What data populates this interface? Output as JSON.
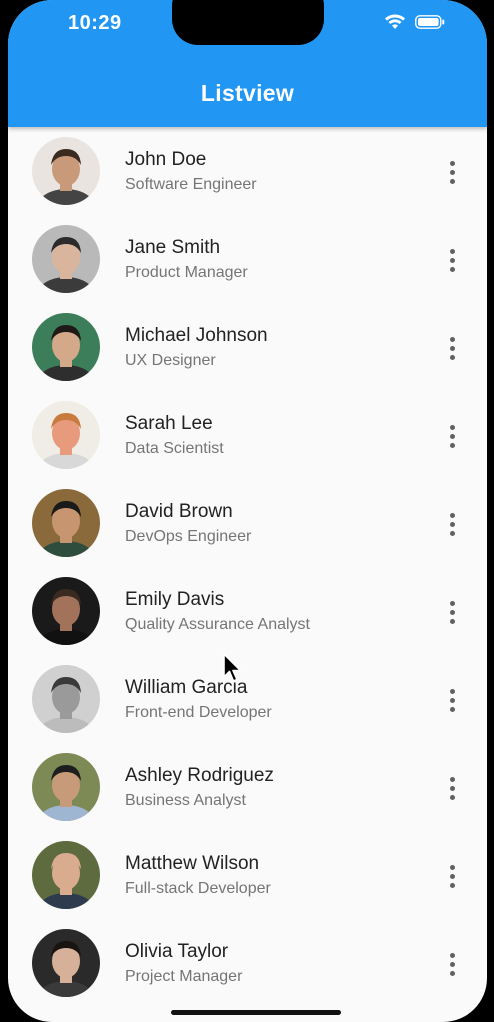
{
  "status_bar": {
    "time": "10:29",
    "icons": [
      "wifi-icon",
      "battery-icon"
    ]
  },
  "app_bar": {
    "title": "Listview",
    "color": "#2196F3"
  },
  "list": [
    {
      "name": "John Doe",
      "role": "Software Engineer",
      "bg": "#e9e4df",
      "skin": "#c99a7a",
      "hair": "#3a2a20",
      "shirt": "#444444"
    },
    {
      "name": "Jane Smith",
      "role": "Product Manager",
      "bg": "#b9b9b9",
      "skin": "#d9b59d",
      "hair": "#2b2b2b",
      "shirt": "#3b3b3b"
    },
    {
      "name": "Michael Johnson",
      "role": "UX Designer",
      "bg": "#3c7d5a",
      "skin": "#d4a98a",
      "hair": "#1f1a17",
      "shirt": "#2e2e2e"
    },
    {
      "name": "Sarah Lee",
      "role": "Data Scientist",
      "bg": "#f0ece6",
      "skin": "#e79a7c",
      "hair": "#c97a3e",
      "shirt": "#d8d8d8"
    },
    {
      "name": "David Brown",
      "role": "DevOps Engineer",
      "bg": "#8a6a3a",
      "skin": "#c79670",
      "hair": "#1a1a1a",
      "shirt": "#2f4d3d"
    },
    {
      "name": "Emily Davis",
      "role": "Quality Assurance Analyst",
      "bg": "#1a1a1a",
      "skin": "#a2735a",
      "hair": "#3a2a20",
      "shirt": "#111111"
    },
    {
      "name": "William Garcia",
      "role": "Front-end Developer",
      "bg": "#d0d0d0",
      "skin": "#9a9a9a",
      "hair": "#3a3a3a",
      "shirt": "#bcbcbc"
    },
    {
      "name": "Ashley Rodriguez",
      "role": "Business Analyst",
      "bg": "#7d8a55",
      "skin": "#c79a7a",
      "hair": "#1e1e1e",
      "shirt": "#9fb6d2"
    },
    {
      "name": "Matthew Wilson",
      "role": "Full-stack Developer",
      "bg": "#5e6b3e",
      "skin": "#d9ab8f",
      "hair": "#d9ab8f",
      "shirt": "#2e3b4e"
    },
    {
      "name": "Olivia Taylor",
      "role": "Project Manager",
      "bg": "#2a2a2a",
      "skin": "#d6b098",
      "hair": "#1a1410",
      "shirt": "#3a3a3a"
    }
  ]
}
